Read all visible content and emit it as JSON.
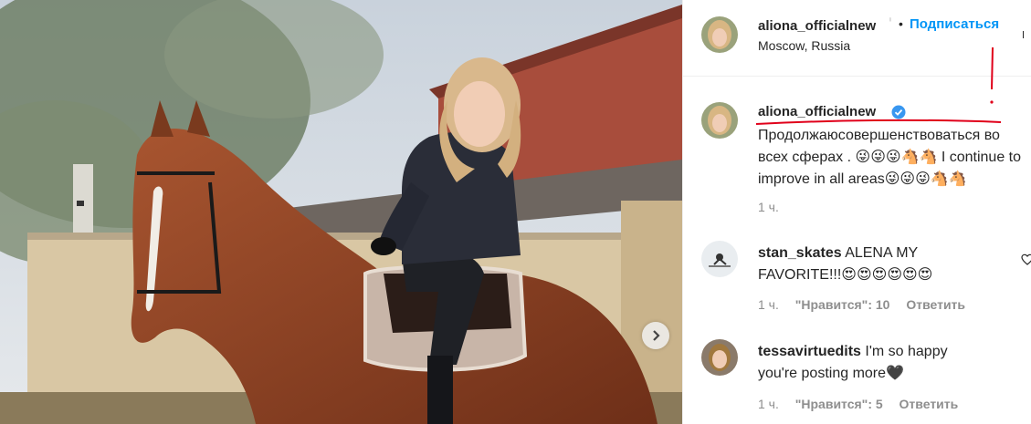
{
  "post": {
    "author": "aliona_officialnew",
    "location": "Moscow, Russia",
    "follow_label": "Подписаться",
    "separator": "•",
    "caption_line1": "Продолжаюсовершенствоваться во",
    "caption_line2": "всех сферах . 😜😜😜🐴🐴 I continue to",
    "caption_line3": "improve in all areas😜😜😜🐴🐴",
    "caption_time": "1 ч.",
    "verified_icon": "verified-badge-icon",
    "colors": {
      "accent": "#0095f6",
      "annotation": "#e0001a"
    }
  },
  "comments": [
    {
      "user": "stan_skates",
      "text_line1": "ALENA MY",
      "text_line2": "FAVORITE!!!😍😍😍😍😍😍",
      "time": "1 ч.",
      "likes": "\"Нравится\": 10",
      "reply": "Ответить"
    },
    {
      "user": "tessavirtuedits",
      "text_line1": "I'm so happy",
      "text_line2": "you're posting more🖤",
      "time": "1 ч.",
      "likes": "\"Нравится\": 5",
      "reply": "Ответить"
    }
  ]
}
